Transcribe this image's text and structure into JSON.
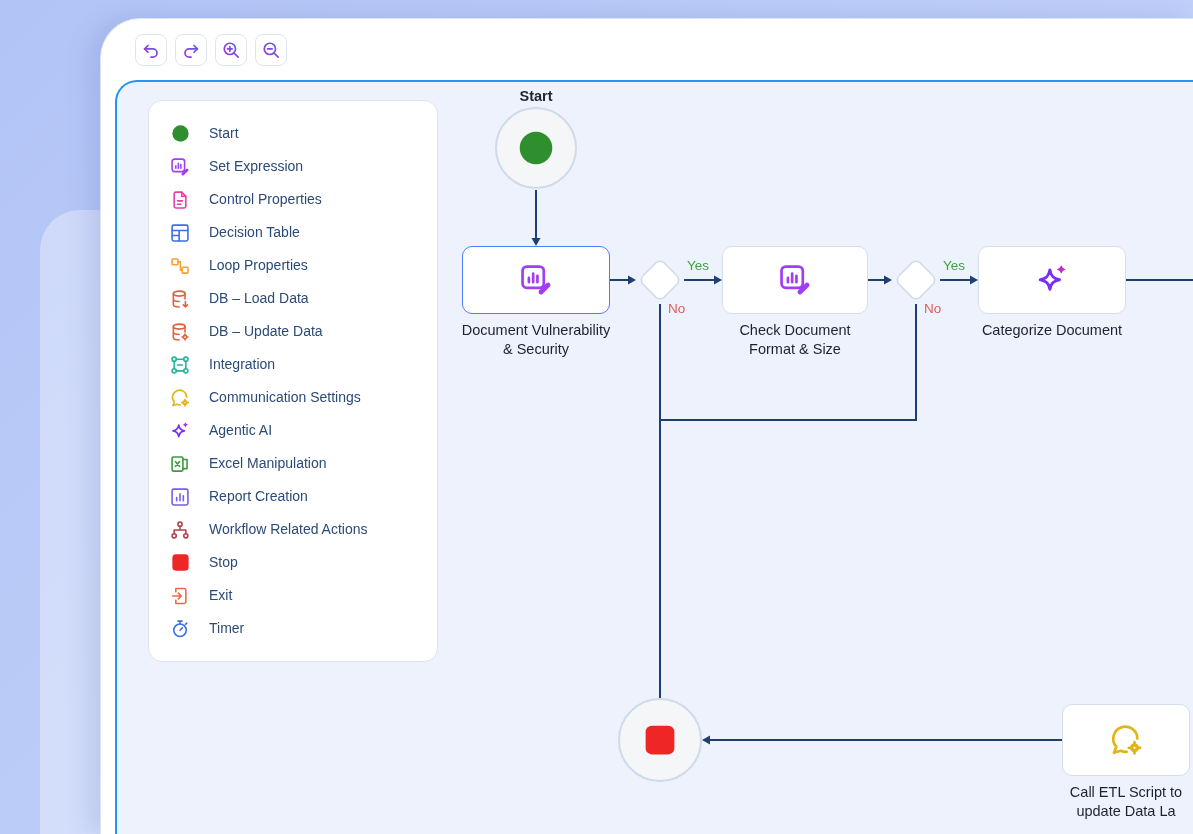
{
  "toolbar": {
    "tools": [
      {
        "kind": "undo"
      },
      {
        "kind": "redo"
      },
      {
        "kind": "zoom-in"
      },
      {
        "kind": "zoom-out"
      }
    ]
  },
  "palette": {
    "items": [
      {
        "kind": "start",
        "label": "Start"
      },
      {
        "kind": "expression",
        "label": "Set Expression"
      },
      {
        "kind": "properties",
        "label": "Control Properties"
      },
      {
        "kind": "table",
        "label": "Decision Table"
      },
      {
        "kind": "loop",
        "label": "Loop Properties"
      },
      {
        "kind": "load",
        "label": "DB – Load Data"
      },
      {
        "kind": "update",
        "label": "DB – Update Data"
      },
      {
        "kind": "integration",
        "label": "Integration"
      },
      {
        "kind": "communication",
        "label": "Communication Settings"
      },
      {
        "kind": "ai",
        "label": "Agentic AI"
      },
      {
        "kind": "excel",
        "label": "Excel Manipulation"
      },
      {
        "kind": "report",
        "label": "Report Creation"
      },
      {
        "kind": "workflow",
        "label": "Workflow Related Actions"
      },
      {
        "kind": "stop",
        "label": "Stop"
      },
      {
        "kind": "exit",
        "label": "Exit"
      },
      {
        "kind": "timer",
        "label": "Timer"
      }
    ]
  },
  "flow": {
    "terminals": [
      {
        "kind": "start",
        "title": "Start"
      },
      {
        "kind": "stop"
      }
    ],
    "nodes": [
      {
        "kind": "expression",
        "lines": [
          "Document Vulnerability",
          "& Security"
        ],
        "selected": true
      },
      {
        "kind": "expression",
        "lines": [
          "Check Document",
          "Format & Size"
        ],
        "selected": false
      },
      {
        "kind": "ai",
        "lines": [
          "Categorize Document"
        ],
        "selected": false
      },
      {
        "kind": "communication",
        "lines": [
          "Call ETL Script to",
          "update Data La"
        ],
        "selected": false
      }
    ],
    "decisions": [
      {
        "branches": [
          {
            "kind": "yes",
            "label": "Yes"
          },
          {
            "kind": "no",
            "label": "No"
          }
        ]
      },
      {
        "branches": [
          {
            "kind": "yes",
            "label": "Yes"
          },
          {
            "kind": "no",
            "label": "No"
          }
        ]
      }
    ]
  }
}
